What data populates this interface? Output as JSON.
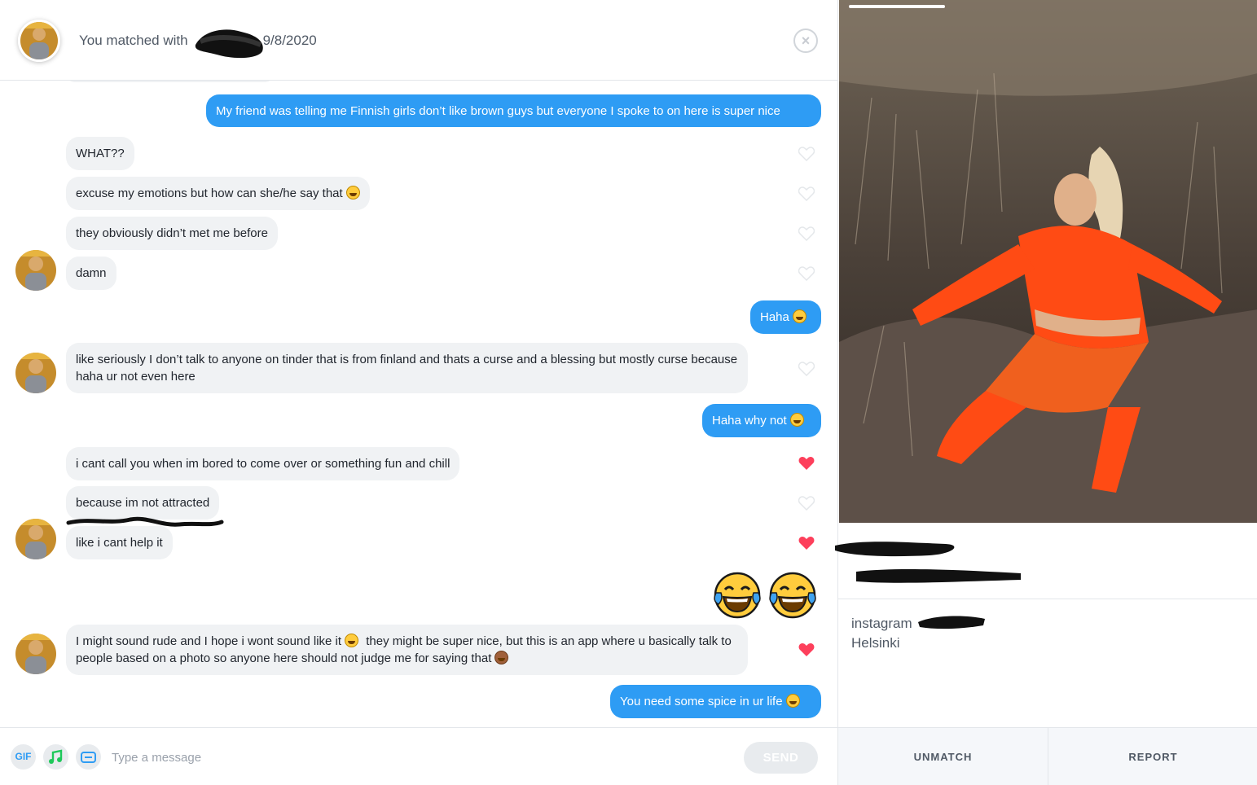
{
  "header": {
    "title_prefix": "You matched with",
    "match_date": "9/8/2020",
    "close_icon": "close-icon"
  },
  "messages": [
    {
      "dir": "out",
      "text": "My friend was telling me Finnish girls don’t like brown guys but everyone I spoke to on here is super nice"
    },
    {
      "dir": "in",
      "text": "WHAT??",
      "liked": false
    },
    {
      "dir": "in",
      "text": "excuse my emotions but how can she/he say that",
      "emoji": "laughing-emoji",
      "liked": false
    },
    {
      "dir": "in",
      "text": "they obviously didn’t met me before",
      "liked": false
    },
    {
      "dir": "in",
      "text": "damn",
      "liked": false
    },
    {
      "dir": "out",
      "text": "Haha",
      "emoji": "grinning-emoji"
    },
    {
      "dir": "in",
      "text": "like seriously I don’t talk to anyone on tinder that is from finland and thats a curse and a blessing but mostly curse because haha ur not even here",
      "liked": false
    },
    {
      "dir": "out",
      "text": "Haha why not",
      "emoji": "grinning-emoji"
    },
    {
      "dir": "in",
      "text": "i cant call you when im bored to come over or something fun and chill",
      "liked": true
    },
    {
      "dir": "in",
      "text": "because im not attracted",
      "liked": false
    },
    {
      "dir": "in",
      "text": "like i cant help it",
      "liked": true
    },
    {
      "dir": "out",
      "emoji_only": [
        "tears-of-joy-emoji",
        "tears-of-joy-emoji"
      ]
    },
    {
      "dir": "in",
      "text_a": "I might sound rude and I hope i wont sound like it",
      "text_b": "they might be super nice, but this is an app where u basically talk to people based on a photo so anyone here should not judge me for saying that",
      "emoji_a": "unamused-emoji",
      "emoji_b": "see-no-evil-monkey-emoji",
      "liked": true
    },
    {
      "dir": "out",
      "text": "You need some spice in ur life",
      "emoji": "smirking-emoji"
    }
  ],
  "composer": {
    "gif_label": "GIF",
    "music_icon": "music-note-icon",
    "sticker_icon": "sticker-icon",
    "placeholder": "Type a message",
    "send_label": "SEND"
  },
  "profile": {
    "bio_line1": "instagram",
    "bio_line2": "Helsinki",
    "unmatch_label": "UNMATCH",
    "report_label": "REPORT"
  },
  "colors": {
    "outgoing_bubble": "#2e9cf4",
    "incoming_bubble": "#f0f2f4",
    "heart_liked": "#fd3f5b",
    "heart_unliked": "#e4e7ea",
    "muted_text": "#505965"
  }
}
